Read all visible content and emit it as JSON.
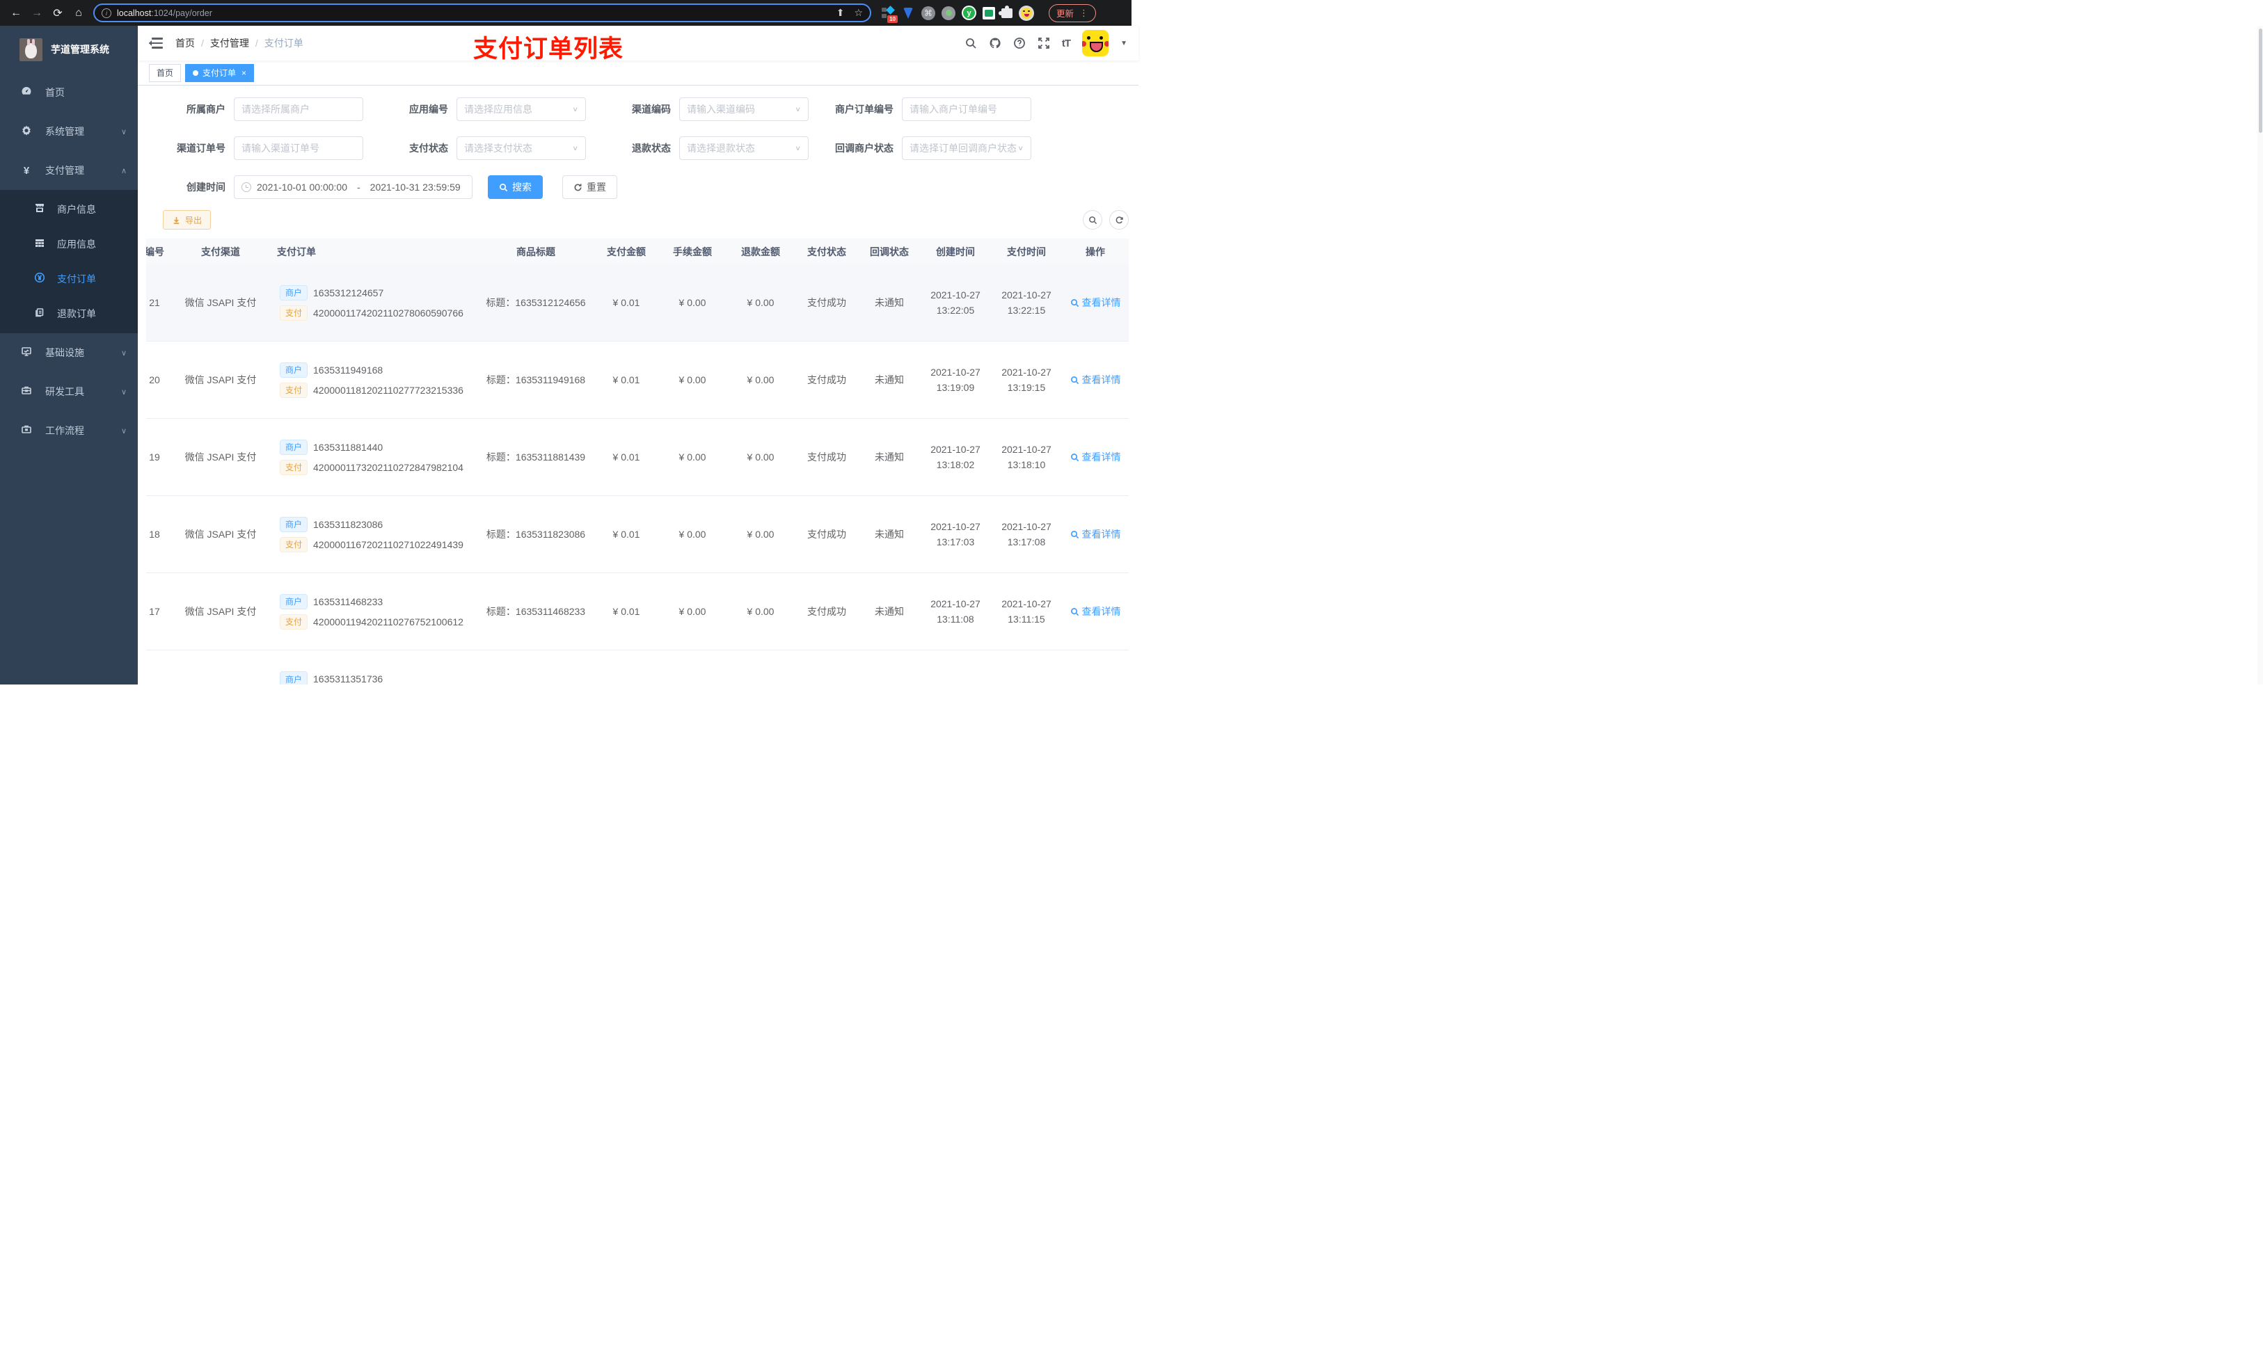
{
  "browser": {
    "url_host": "localhost",
    "url_rest": ":1024/pay/order",
    "ext_badge": "10",
    "ext_y": "y",
    "update_label": "更新"
  },
  "icons": {
    "back": "←",
    "forward": "→",
    "reload": "⟳",
    "home": "⌂",
    "share": "⬆",
    "star": "☆",
    "info": "i",
    "command": "⌘",
    "vdots": "⋮",
    "caret_down": "▼",
    "chevron_down": "∨",
    "menu_chev_down": "∨",
    "menu_chev_up": "∧",
    "tab_close": "×",
    "yen": "¥",
    "qmark": "?",
    "tT": "tT",
    "date_sep": "-"
  },
  "sidebar": {
    "title": "芋道管理系统",
    "home": "首页",
    "system": "系统管理",
    "payment": "支付管理",
    "sub_merchant": "商户信息",
    "sub_app": "应用信息",
    "sub_pay_order": "支付订单",
    "sub_refund": "退款订单",
    "infra": "基础设施",
    "devtools": "研发工具",
    "workflow": "工作流程"
  },
  "header": {
    "breadcrumb_1": "首页",
    "breadcrumb_2": "支付管理",
    "breadcrumb_3": "支付订单",
    "annotation": "支付订单列表",
    "tab_home": "首页",
    "tab_active": "支付订单"
  },
  "filters": {
    "f1": {
      "label": "所属商户",
      "placeholder": "请选择所属商户"
    },
    "f2": {
      "label": "应用编号",
      "placeholder": "请选择应用信息"
    },
    "f3": {
      "label": "渠道编码",
      "placeholder": "请输入渠道编码"
    },
    "f4": {
      "label": "商户订单编号",
      "placeholder": "请输入商户订单编号"
    },
    "f5": {
      "label": "渠道订单号",
      "placeholder": "请输入渠道订单号"
    },
    "f6": {
      "label": "支付状态",
      "placeholder": "请选择支付状态"
    },
    "f7": {
      "label": "退款状态",
      "placeholder": "请选择退款状态"
    },
    "f8": {
      "label": "回调商户状态",
      "placeholder": "请选择订单回调商户状态"
    },
    "date": {
      "label": "创建时间",
      "start": "2021-10-01 00:00:00",
      "end": "2021-10-31 23:59:59"
    },
    "search_label": "搜索",
    "reset_label": "重置"
  },
  "toolbar": {
    "export_label": "导出"
  },
  "table": {
    "col_id": "编号",
    "col_channel": "支付渠道",
    "col_order": "支付订单",
    "col_title": "商品标题",
    "col_amount": "支付金额",
    "col_fee": "手续金额",
    "col_refund": "退款金额",
    "col_status": "支付状态",
    "col_notify": "回调状态",
    "col_created": "创建时间",
    "col_paid": "支付时间",
    "col_action": "操作",
    "merchant_tag": "商户",
    "pay_tag": "支付",
    "title_prefix": "标题：",
    "view_label": "查看详情",
    "rows": [
      {
        "id": "21",
        "channel": "微信 JSAPI 支付",
        "merchant_no": "1635312124657",
        "pay_no": "4200001174202110278060590766",
        "title": "1635312124656",
        "amount": "¥ 0.01",
        "fee": "¥ 0.00",
        "refund": "¥ 0.00",
        "status": "支付成功",
        "notify": "未通知",
        "created_date": "2021-10-27",
        "created_time": "13:22:05",
        "paid_date": "2021-10-27",
        "paid_time": "13:22:15"
      },
      {
        "id": "20",
        "channel": "微信 JSAPI 支付",
        "merchant_no": "1635311949168",
        "pay_no": "4200001181202110277723215336",
        "title": "1635311949168",
        "amount": "¥ 0.01",
        "fee": "¥ 0.00",
        "refund": "¥ 0.00",
        "status": "支付成功",
        "notify": "未通知",
        "created_date": "2021-10-27",
        "created_time": "13:19:09",
        "paid_date": "2021-10-27",
        "paid_time": "13:19:15"
      },
      {
        "id": "19",
        "channel": "微信 JSAPI 支付",
        "merchant_no": "1635311881440",
        "pay_no": "4200001173202110272847982104",
        "title": "1635311881439",
        "amount": "¥ 0.01",
        "fee": "¥ 0.00",
        "refund": "¥ 0.00",
        "status": "支付成功",
        "notify": "未通知",
        "created_date": "2021-10-27",
        "created_time": "13:18:02",
        "paid_date": "2021-10-27",
        "paid_time": "13:18:10"
      },
      {
        "id": "18",
        "channel": "微信 JSAPI 支付",
        "merchant_no": "1635311823086",
        "pay_no": "4200001167202110271022491439",
        "title": "1635311823086",
        "amount": "¥ 0.01",
        "fee": "¥ 0.00",
        "refund": "¥ 0.00",
        "status": "支付成功",
        "notify": "未通知",
        "created_date": "2021-10-27",
        "created_time": "13:17:03",
        "paid_date": "2021-10-27",
        "paid_time": "13:17:08"
      },
      {
        "id": "17",
        "channel": "微信 JSAPI 支付",
        "merchant_no": "1635311468233",
        "pay_no": "4200001194202110276752100612",
        "title": "1635311468233",
        "amount": "¥ 0.01",
        "fee": "¥ 0.00",
        "refund": "¥ 0.00",
        "status": "支付成功",
        "notify": "未通知",
        "created_date": "2021-10-27",
        "created_time": "13:11:08",
        "paid_date": "2021-10-27",
        "paid_time": "13:11:15"
      }
    ],
    "partial": {
      "merchant_no": "1635311351736"
    }
  }
}
